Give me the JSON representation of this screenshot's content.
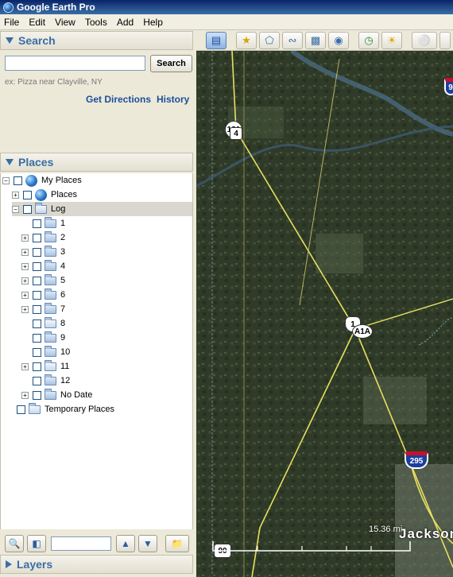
{
  "window": {
    "title": "Google Earth Pro"
  },
  "menu": [
    "File",
    "Edit",
    "View",
    "Tools",
    "Add",
    "Help"
  ],
  "search_panel": {
    "title": "Search",
    "input_value": "",
    "button_label": "Search",
    "hint": "ex: Pizza near Clayville, NY",
    "get_directions": "Get Directions",
    "history": "History"
  },
  "places_panel": {
    "title": "Places",
    "tree": {
      "my_places": "My Places",
      "places": "Places",
      "log": "Log",
      "log_children": [
        "1",
        "2",
        "3",
        "4",
        "5",
        "6",
        "7",
        "8",
        "9",
        "10",
        "11",
        "12",
        "No Date"
      ],
      "temporary": "Temporary Places"
    }
  },
  "layers_panel": {
    "title": "Layers"
  },
  "map": {
    "shields": {
      "us1": "1",
      "sr4": "4",
      "sr121": "121",
      "a1a": "A1A",
      "i295": "295",
      "i9": "9",
      "i90": "90"
    },
    "scale": "15.36 mi",
    "city_label": "Jacksonvil"
  }
}
